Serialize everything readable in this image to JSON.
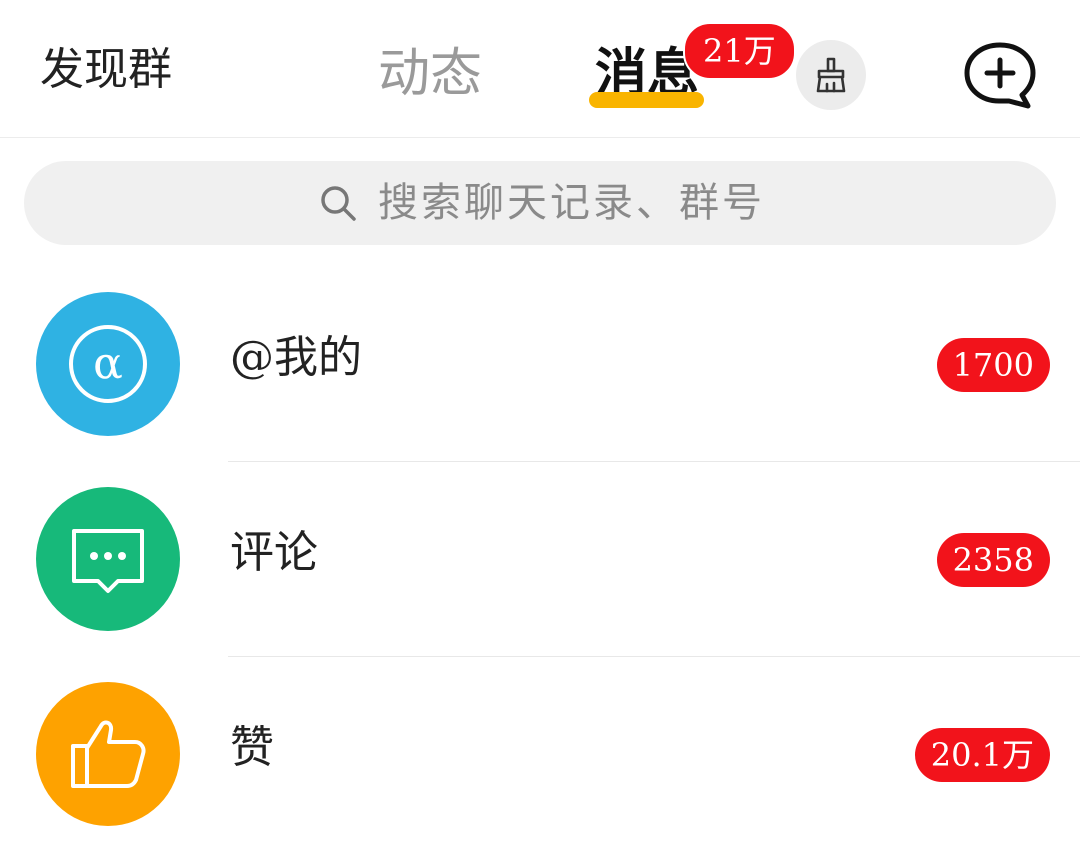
{
  "header": {
    "discover_label": "发现群",
    "tabs": [
      {
        "label": "动态",
        "active": false
      },
      {
        "label": "消息",
        "active": true,
        "badge": "21万"
      }
    ],
    "clear_icon": "broom-icon",
    "new_chat_icon": "chat-plus-icon"
  },
  "search": {
    "placeholder": "搜索聊天记录、群号",
    "icon": "search-icon"
  },
  "items": [
    {
      "label": "@我的",
      "count": "1700",
      "icon": "at-icon",
      "color": "#2fb2e3"
    },
    {
      "label": "评论",
      "count": "2358",
      "icon": "comment-icon",
      "color": "#17b97a"
    },
    {
      "label": "赞",
      "count": "20.1万",
      "icon": "thumbs-up-icon",
      "color": "#fea200"
    }
  ],
  "colors": {
    "badge": "#f2131b",
    "tab_indicator": "#f9b400",
    "inactive_tab": "#9a9a9a"
  }
}
